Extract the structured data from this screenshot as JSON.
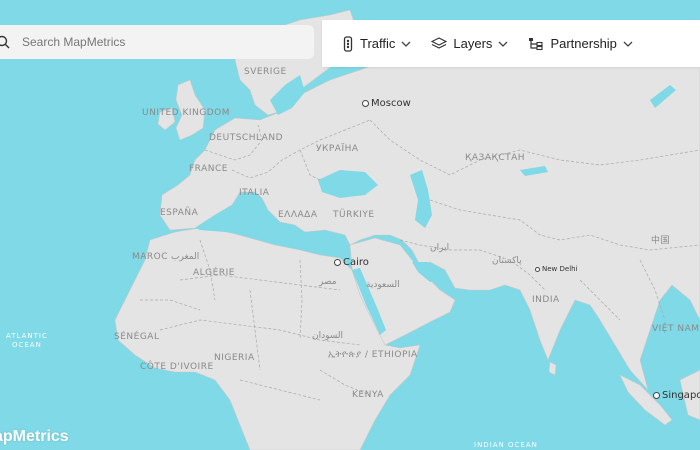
{
  "search": {
    "placeholder": "Search MapMetrics",
    "icon": "search-icon"
  },
  "menu": [
    {
      "label": "Traffic",
      "icon": "traffic-light-icon"
    },
    {
      "label": "Layers",
      "icon": "layers-icon"
    },
    {
      "label": "Partnership",
      "icon": "partnership-icon"
    }
  ],
  "cities": {
    "moscow": "Moscow",
    "cairo": "Cairo",
    "new_delhi": "New Delhi",
    "singapore": "Singapore"
  },
  "countries": {
    "sverige": "SVERIGE",
    "uk": "UNITED KINGDOM",
    "deutschland": "DEUTSCHLAND",
    "ukraina": "УКРАЇНА",
    "kazakhstan": "ҚАЗАҚСТАН",
    "france": "FRANCE",
    "italia": "ITALIA",
    "espana": "ESPAÑA",
    "ellada": "ΕΛΛΑΔΑ",
    "turkiye": "TÜRKIYE",
    "china": "中国",
    "iran": "ایران",
    "pakistan": "پاکستان",
    "maroc": "MAROC",
    "maghrib": "المغرب",
    "algerie": "ALGÉRIE",
    "misr": "مصر",
    "saudi": "السعودية",
    "india": "INDIA",
    "senegal": "SÉNÉGAL",
    "sudan": "السودان",
    "vietnam": "VIỆT NAM",
    "cote": "CÔTE D'IVOIRE",
    "nigeria": "NIGERIA",
    "ethiopia": "ኢትዮጵያ / ETHIOPIA",
    "kenya": "KENYA"
  },
  "seas": {
    "atlantic": "ATLANTIC\nOCEAN",
    "indian": "INDIAN OCEAN"
  },
  "logo": "apMetrics",
  "colors": {
    "water": "#7fd9e6",
    "land": "#e4e4e4",
    "border": "#a8a8a8",
    "topbar": "#ffffff"
  }
}
